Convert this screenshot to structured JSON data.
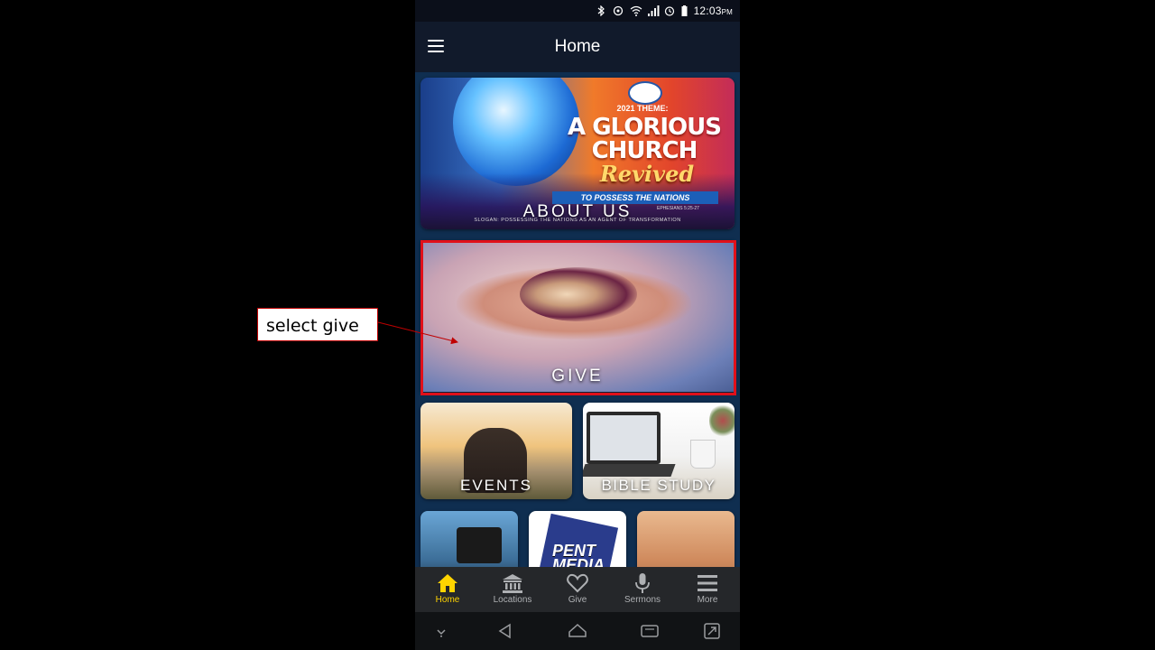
{
  "status_bar": {
    "time": "12:03",
    "ampm": "PM",
    "icons": [
      "bluetooth-icon",
      "sync-icon",
      "wifi-icon",
      "signal-icon",
      "alarm-icon",
      "battery-icon"
    ]
  },
  "app_bar": {
    "title": "Home",
    "menu_icon": "hamburger-menu-icon"
  },
  "cards": {
    "about": {
      "label": "ABOUT US",
      "banner_year": "2021 THEME:",
      "banner_line1": "A GLORIOUS",
      "banner_line2": "CHURCH",
      "banner_revived": "Revived",
      "banner_subtitle": "TO POSSESS THE NATIONS",
      "banner_reference": "EPHESIANS 5:25-27",
      "banner_slogan": "SLOGAN: POSSESSING THE NATIONS AS AN AGENT OF TRANSFORMATION"
    },
    "give": {
      "label": "GIVE"
    },
    "events": {
      "label": "EVENTS"
    },
    "bible_study": {
      "label": "BIBLE STUDY"
    },
    "pent_media": {
      "logo_text_line1": "PENT",
      "logo_text_line2": "MEDIA"
    }
  },
  "bottom_nav": {
    "active_color": "#ffd400",
    "items": [
      {
        "label": "Home",
        "icon": "home-icon",
        "active": true
      },
      {
        "label": "Locations",
        "icon": "bank-building-icon",
        "active": false
      },
      {
        "label": "Give",
        "icon": "heart-icon",
        "active": false
      },
      {
        "label": "Sermons",
        "icon": "microphone-icon",
        "active": false
      },
      {
        "label": "More",
        "icon": "menu-lines-icon",
        "active": false
      }
    ]
  },
  "system_nav": {
    "icons": [
      "hide-keyboard-icon",
      "back-icon",
      "home-outline-icon",
      "recents-icon",
      "screen-rotate-icon"
    ]
  },
  "annotation": {
    "callout_text": "select give",
    "highlight_color": "#e0101a"
  }
}
